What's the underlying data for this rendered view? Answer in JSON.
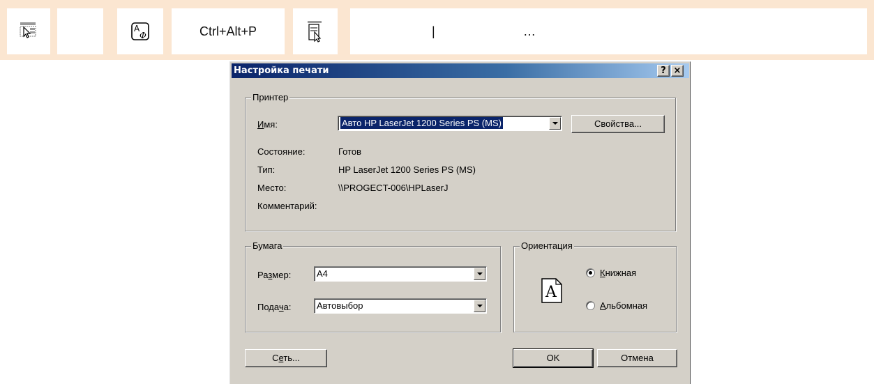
{
  "toolbar": {
    "icons": [
      "print-preview-icon",
      "font-format-icon",
      "page-setup-icon"
    ],
    "shortcut": "Ctrl+Alt+P",
    "separator": "|",
    "ellipsis": "…"
  },
  "dialog": {
    "title": "Настройка печати",
    "help_btn": "?",
    "close_btn": "×",
    "printer": {
      "group_label": "Принтер",
      "name_label": "Имя:",
      "name_value": "Авто HP LaserJet 1200 Series PS (MS) ",
      "properties_button": "Свойства...",
      "status_label": "Состояние:",
      "status_value": "Готов",
      "type_label": "Тип:",
      "type_value": "HP LaserJet 1200 Series PS (MS)",
      "location_label": "Место:",
      "location_value": "\\\\PROGECT-006\\HPLaserJ",
      "comment_label": "Комментарий:"
    },
    "paper": {
      "group_label": "Бумага",
      "size_label": "Размер:",
      "size_value": "A4",
      "source_label": "Подача:",
      "source_value": "Автовыбор"
    },
    "orientation": {
      "group_label": "Ориентация",
      "portrait": "Книжная",
      "landscape": "Альбомная",
      "selected": "portrait",
      "page_glyph": "A"
    },
    "network_button": "Сеть...",
    "ok_button": "OK",
    "cancel_button": "Отмена"
  }
}
